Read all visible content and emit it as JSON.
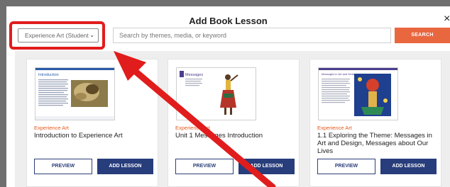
{
  "modal": {
    "title": "Add Book Lesson",
    "close_icon": "×"
  },
  "filter": {
    "selected": "Experience Art (Student",
    "caret": "⌄"
  },
  "search": {
    "placeholder": "Search by themes, media, or keyword",
    "button_label": "SEARCH"
  },
  "cards": [
    {
      "category": "Experience Art",
      "title": "Introduction to Experience Art",
      "thumb_heading": "Introduction",
      "preview_label": "PREVIEW",
      "add_label": "ADD LESSON"
    },
    {
      "category": "Experience Art",
      "title": "Unit 1 Messages Introduction",
      "thumb_heading": "Messages",
      "preview_label": "PREVIEW",
      "add_label": "ADD LESSON"
    },
    {
      "category": "Experience Art",
      "title": "1.1 Exploring the Theme: Messages in Art and Design, Messages about Our Lives",
      "thumb_heading": "Messages in Art and Design",
      "preview_label": "PREVIEW",
      "add_label": "ADD LESSON"
    }
  ],
  "colors": {
    "highlight": "#e11c1c",
    "accent": "#e9673f",
    "primary": "#283d7b"
  }
}
